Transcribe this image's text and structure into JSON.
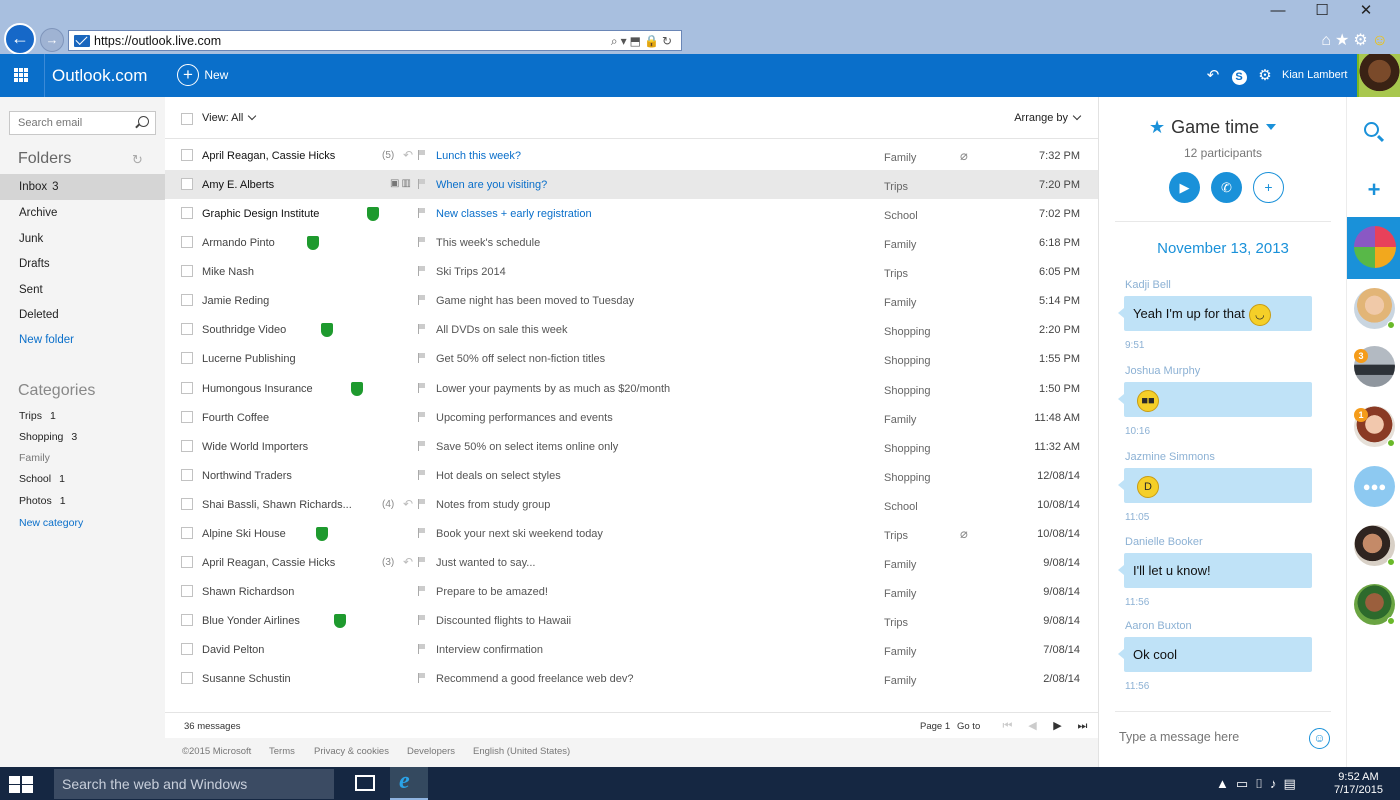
{
  "browser": {
    "url": "https://outlook.live.com",
    "window_controls": [
      "—",
      "☐",
      "✕"
    ]
  },
  "header": {
    "brand": "Outlook.com",
    "new_label": "New",
    "user_name": "Kian Lambert"
  },
  "sidebar": {
    "search_placeholder": "Search email",
    "folders_title": "Folders",
    "folders": [
      {
        "label": "Inbox",
        "count": "3"
      },
      {
        "label": "Archive",
        "count": ""
      },
      {
        "label": "Junk",
        "count": ""
      },
      {
        "label": "Drafts",
        "count": ""
      },
      {
        "label": "Sent",
        "count": ""
      },
      {
        "label": "Deleted",
        "count": ""
      }
    ],
    "new_folder": "New folder",
    "categories_title": "Categories",
    "categories": [
      {
        "label": "Trips",
        "count": "1"
      },
      {
        "label": "Shopping",
        "count": "3"
      },
      {
        "label": "Family",
        "count": ""
      },
      {
        "label": "School",
        "count": "1"
      },
      {
        "label": "Photos",
        "count": "1"
      }
    ],
    "new_category": "New category"
  },
  "toolbar": {
    "view_label": "View: All",
    "arrange_label": "Arrange by"
  },
  "messages": [
    {
      "sender": "April Reagan, Cassie Hicks",
      "count": "(5)",
      "subject": "Lunch this week?",
      "category": "Family",
      "time": "7:32 PM"
    },
    {
      "sender": "Amy E. Alberts",
      "count": "",
      "subject": "When are you visiting?",
      "category": "Trips",
      "time": "7:20 PM"
    },
    {
      "sender": "Graphic Design Institute",
      "count": "",
      "subject": "New classes + early registration",
      "category": "School",
      "time": "7:02 PM"
    },
    {
      "sender": "Armando Pinto",
      "count": "",
      "subject": "This week's schedule",
      "category": "Family",
      "time": "6:18 PM"
    },
    {
      "sender": "Mike Nash",
      "count": "",
      "subject": "Ski Trips 2014",
      "category": "Trips",
      "time": "6:05 PM"
    },
    {
      "sender": "Jamie Reding",
      "count": "",
      "subject": "Game night has been moved to Tuesday",
      "category": "Family",
      "time": "5:14 PM"
    },
    {
      "sender": "Southridge Video",
      "count": "",
      "subject": "All DVDs on sale this week",
      "category": "Shopping",
      "time": "2:20 PM"
    },
    {
      "sender": "Lucerne Publishing",
      "count": "",
      "subject": "Get 50% off select non-fiction titles",
      "category": "Shopping",
      "time": "1:55 PM"
    },
    {
      "sender": "Humongous Insurance",
      "count": "",
      "subject": "Lower your payments by as much as $20/month",
      "category": "Shopping",
      "time": "1:50 PM"
    },
    {
      "sender": "Fourth Coffee",
      "count": "",
      "subject": "Upcoming performances and events",
      "category": "Family",
      "time": "11:48 AM"
    },
    {
      "sender": "Wide World Importers",
      "count": "",
      "subject": "Save 50% on select items online only",
      "category": "Shopping",
      "time": "11:32 AM"
    },
    {
      "sender": "Northwind Traders",
      "count": "",
      "subject": "Hot deals on select styles",
      "category": "Shopping",
      "time": "12/08/14"
    },
    {
      "sender": "Shai Bassli, Shawn Richards...",
      "count": "(4)",
      "subject": "Notes from study group",
      "category": "School",
      "time": "10/08/14"
    },
    {
      "sender": "Alpine Ski House",
      "count": "",
      "subject": "Book your next ski weekend today",
      "category": "Trips",
      "time": "10/08/14"
    },
    {
      "sender": "April Reagan, Cassie Hicks",
      "count": "(3)",
      "subject": "Just wanted to say...",
      "category": "Family",
      "time": "9/08/14"
    },
    {
      "sender": "Shawn Richardson",
      "count": "",
      "subject": "Prepare to be amazed!",
      "category": "Family",
      "time": "9/08/14"
    },
    {
      "sender": "Blue Yonder Airlines",
      "count": "",
      "subject": "Discounted flights to Hawaii",
      "category": "Trips",
      "time": "9/08/14"
    },
    {
      "sender": "David Pelton",
      "count": "",
      "subject": "Interview confirmation",
      "category": "Family",
      "time": "7/08/14"
    },
    {
      "sender": "Susanne Schustin",
      "count": "",
      "subject": "Recommend a good freelance web dev?",
      "category": "Family",
      "time": "2/08/14"
    }
  ],
  "list_footer": {
    "count": "36 messages",
    "page": "Page 1",
    "goto": "Go to"
  },
  "site_footer": {
    "copyright": "©2015 Microsoft",
    "terms": "Terms",
    "privacy": "Privacy & cookies",
    "developers": "Developers",
    "language": "English (United States)"
  },
  "chat": {
    "title": "Game time",
    "participants": "12 participants",
    "date": "November 13, 2013",
    "messages": [
      {
        "name": "Kadji Bell",
        "text": "Yeah I'm up for that",
        "time": "9:51"
      },
      {
        "name": "Joshua Murphy",
        "text": "",
        "time": "10:16"
      },
      {
        "name": "Jazmine Simmons",
        "text": "",
        "time": "11:05"
      },
      {
        "name": "Danielle Booker",
        "text": "I'll let u know!",
        "time": "11:56"
      },
      {
        "name": "Aaron Buxton",
        "text": "Ok cool",
        "time": "11:56"
      }
    ],
    "input_placeholder": "Type a message here"
  },
  "rail": {
    "badges": [
      "3",
      "1"
    ]
  },
  "taskbar": {
    "search_placeholder": "Search the web and Windows",
    "time": "9:52 AM",
    "date": "7/17/2015"
  }
}
